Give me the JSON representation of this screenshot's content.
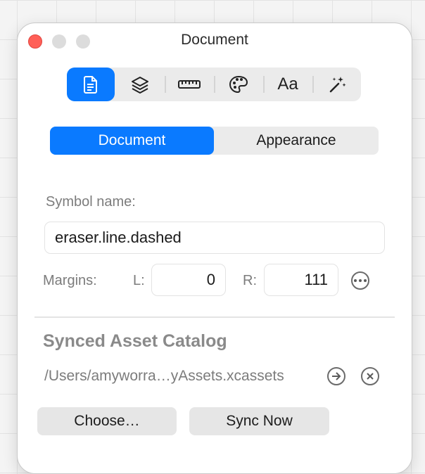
{
  "window": {
    "title": "Document"
  },
  "toolbar": {
    "items": [
      {
        "icon": "document-icon",
        "active": true
      },
      {
        "icon": "layers-icon",
        "active": false
      },
      {
        "icon": "ruler-icon",
        "active": false
      },
      {
        "icon": "palette-icon",
        "active": false
      },
      {
        "icon": "font-icon",
        "label": "Aa",
        "active": false
      },
      {
        "icon": "magic-wand-icon",
        "active": false
      }
    ]
  },
  "segmented": {
    "tabs": [
      "Document",
      "Appearance"
    ],
    "selected": "Document"
  },
  "symbol": {
    "label": "Symbol name:",
    "value": "eraser.line.dashed"
  },
  "margins": {
    "label": "Margins:",
    "left_label": "L:",
    "left_value": "0",
    "right_label": "R:",
    "right_value": "111"
  },
  "catalog": {
    "title": "Synced Asset Catalog",
    "path": "/Users/amyworra…yAssets.xcassets",
    "choose_label": "Choose…",
    "sync_label": "Sync Now"
  },
  "colors": {
    "accent": "#0a7aff",
    "close": "#ff5f57"
  }
}
